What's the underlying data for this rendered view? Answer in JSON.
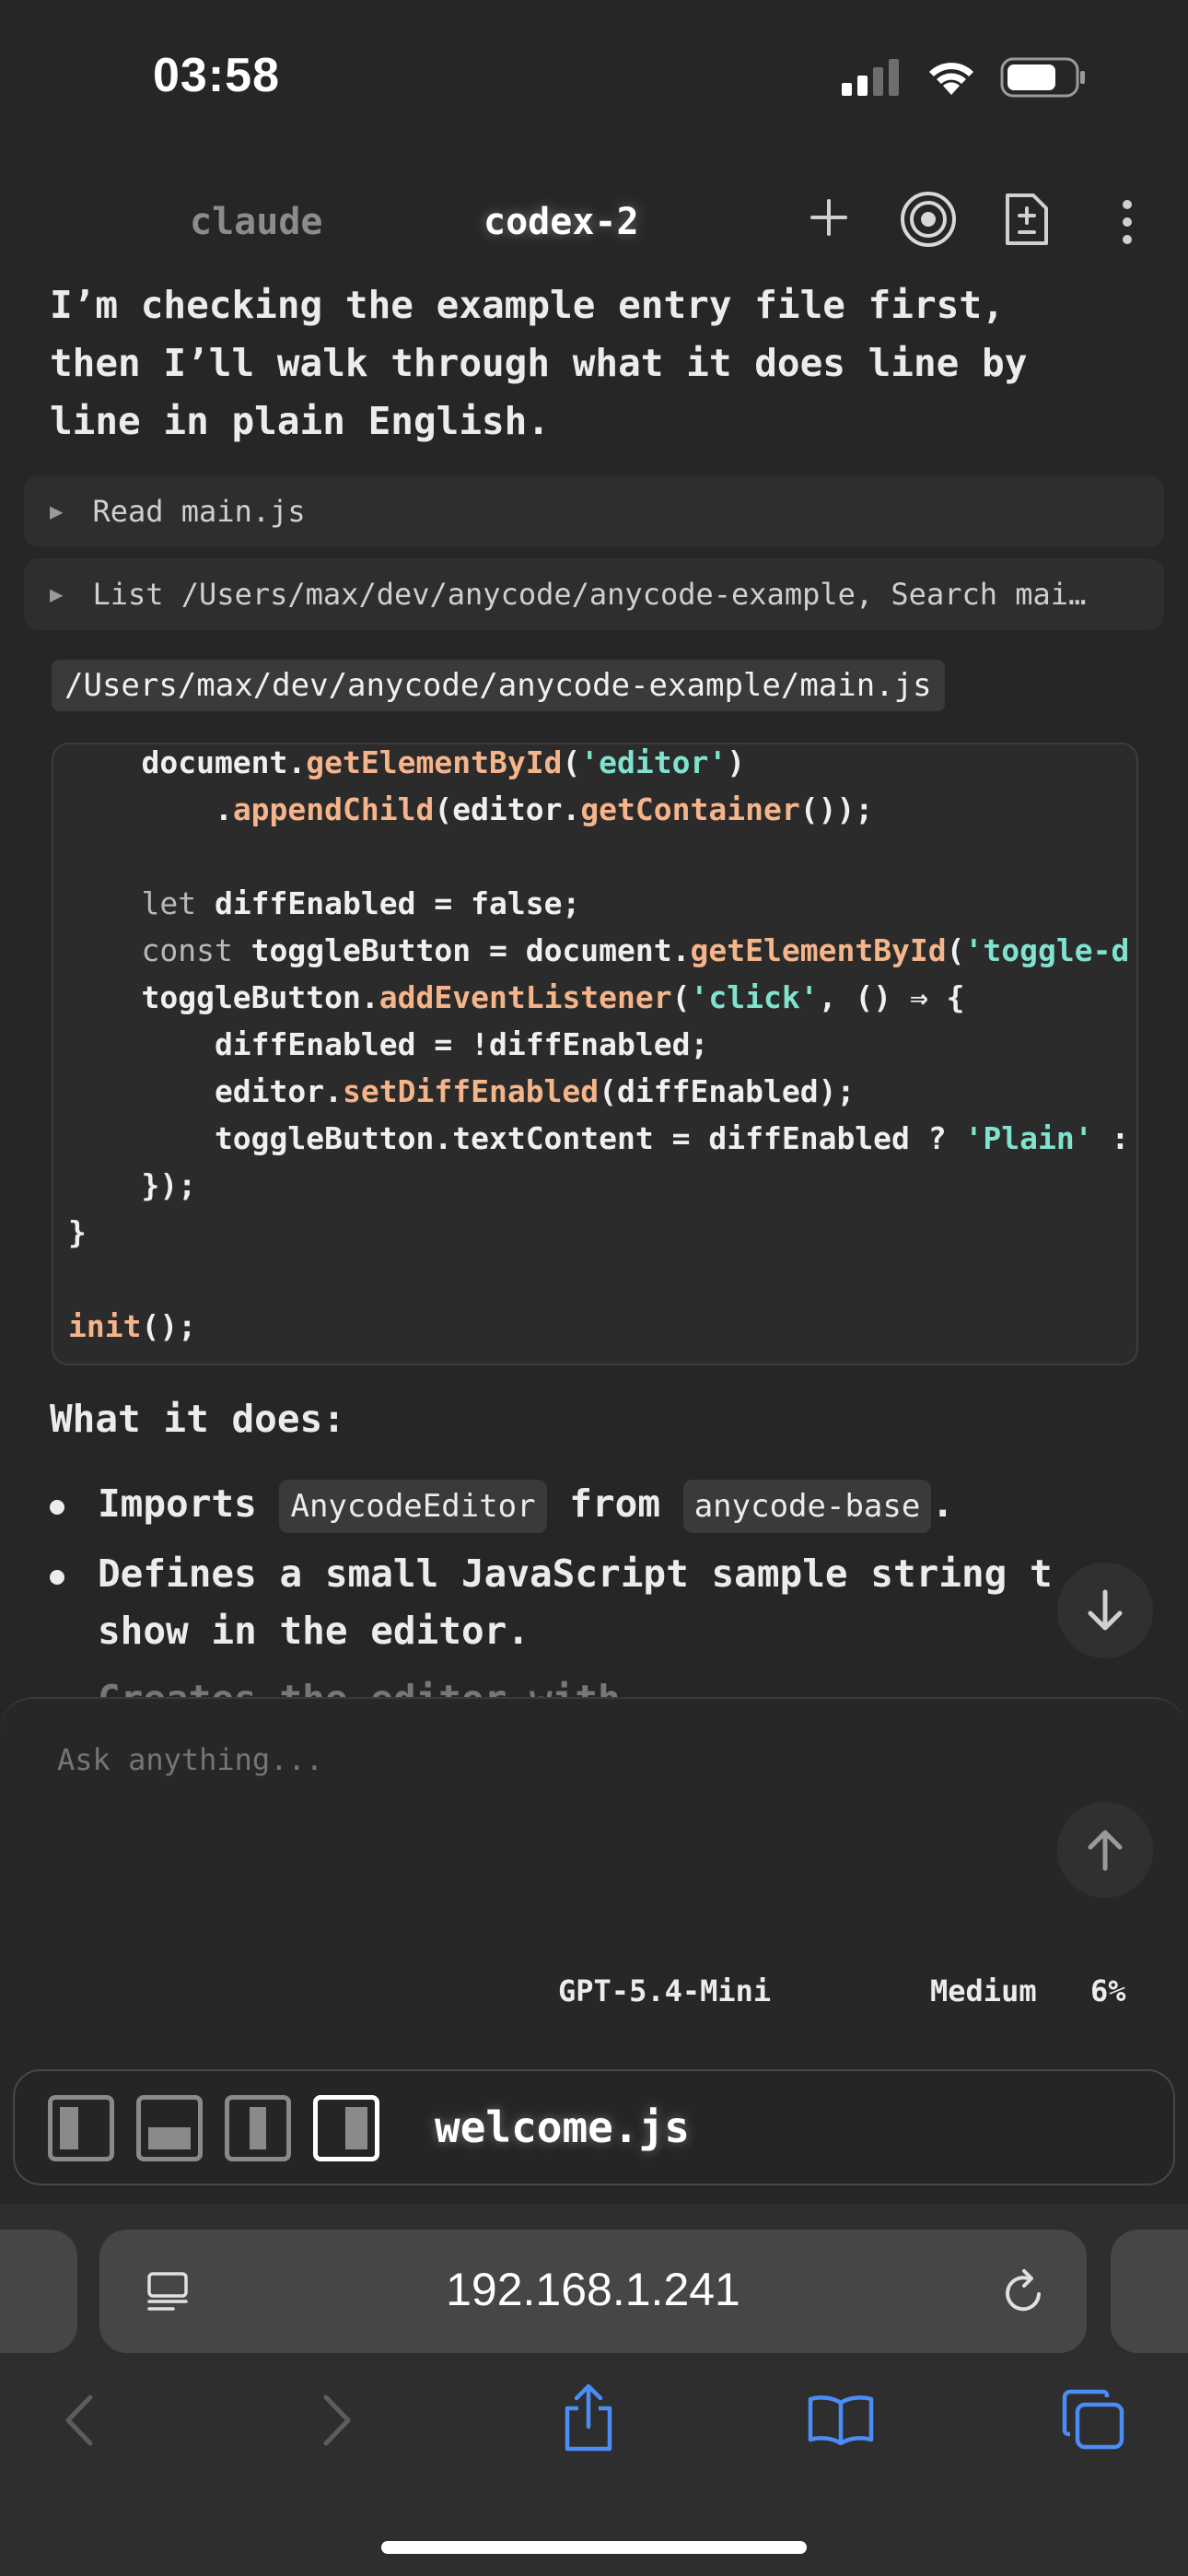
{
  "status_bar": {
    "time": "03:58"
  },
  "tabs": [
    {
      "label": "claude"
    },
    {
      "label": "codex-2"
    }
  ],
  "message": {
    "intro_lines": [
      "I’m checking the example entry file first,",
      "then I’ll walk through what it does line by",
      "line in plain English."
    ],
    "tool_calls": [
      {
        "label": "Read main.js"
      },
      {
        "label": "List /Users/max/dev/anycode/anycode-example, Search mai…"
      }
    ],
    "file_path": "/Users/max/dev/anycode/anycode-example/main.js",
    "code_lines": [
      [
        [
          "t",
          "    document."
        ],
        [
          "f",
          "getElementById"
        ],
        [
          "t",
          "("
        ],
        [
          "s",
          "'editor'"
        ],
        [
          "t",
          ")"
        ]
      ],
      [
        [
          "t",
          "        ."
        ],
        [
          "f",
          "appendChild"
        ],
        [
          "t",
          "(editor."
        ],
        [
          "f",
          "getContainer"
        ],
        [
          "t",
          "());"
        ]
      ],
      [],
      [
        [
          "k",
          "    let"
        ],
        [
          "t",
          " diffEnabled = false;"
        ]
      ],
      [
        [
          "k",
          "    const"
        ],
        [
          "t",
          " toggleButton = document."
        ],
        [
          "f",
          "getElementById"
        ],
        [
          "t",
          "("
        ],
        [
          "s",
          "'toggle-d"
        ]
      ],
      [
        [
          "t",
          "    toggleButton."
        ],
        [
          "f",
          "addEventListener"
        ],
        [
          "t",
          "("
        ],
        [
          "s",
          "'click'"
        ],
        [
          "t",
          ", () ⇒ {"
        ]
      ],
      [
        [
          "t",
          "        diffEnabled = !diffEnabled;"
        ]
      ],
      [
        [
          "t",
          "        editor."
        ],
        [
          "f",
          "setDiffEnabled"
        ],
        [
          "t",
          "(diffEnabled);"
        ]
      ],
      [
        [
          "t",
          "        toggleButton.textContent = diffEnabled ? "
        ],
        [
          "s",
          "'Plain'"
        ],
        [
          "t",
          " :"
        ]
      ],
      [
        [
          "t",
          "    });"
        ]
      ],
      [
        [
          "t",
          "}"
        ]
      ],
      [],
      [
        [
          "f",
          "init"
        ],
        [
          "t",
          "();"
        ]
      ]
    ],
    "heading": "What it does:",
    "bullets": {
      "b1": {
        "pre": "Imports ",
        "code1": "AnycodeEditor",
        "mid": " from ",
        "code2": "anycode-base",
        "post": "."
      },
      "b2_line1": "Defines a small JavaScript sample string t",
      "b2_line2": "show in the editor.",
      "b3_partial": "Creates the editor with..."
    }
  },
  "composer": {
    "placeholder": "Ask anything...",
    "model": "GPT-5.4-Mini",
    "effort": "Medium",
    "context_percent": "6%"
  },
  "file_bar": {
    "file_name": "welcome.js"
  },
  "browser": {
    "url": "192.168.1.241"
  }
}
